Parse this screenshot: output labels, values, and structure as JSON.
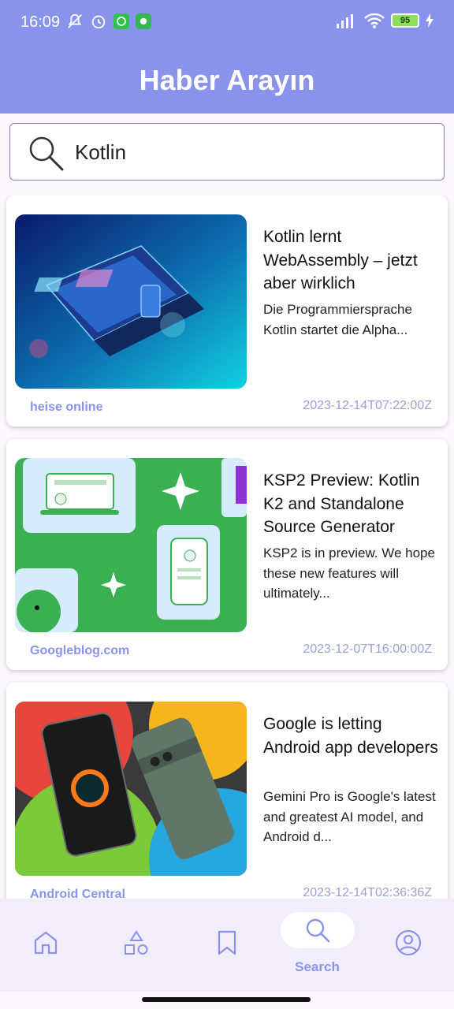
{
  "status_bar": {
    "time": "16:09",
    "battery_level": "95",
    "icons": [
      "mute-icon",
      "alarm-icon",
      "whatsapp-icon",
      "android-notification-icon",
      "signal-icon",
      "wifi-icon",
      "battery-icon",
      "charging-icon"
    ]
  },
  "app": {
    "title": "Haber Arayın"
  },
  "search": {
    "query": "Kotlin",
    "icon": "search-icon"
  },
  "articles": [
    {
      "title": "Kotlin lernt WebAssembly – jetzt aber wirklich",
      "description": "Die Programmiersprache Kotlin startet die Alpha...",
      "source": "heise online",
      "published_at": "2023-12-14T07:22:00Z"
    },
    {
      "title": "KSP2 Preview: Kotlin K2 and Standalone Source Generator",
      "description": "KSP2 is in preview. We hope these new features will ultimately...",
      "source": "Googleblog.com",
      "published_at": "2023-12-07T16:00:00Z"
    },
    {
      "title": "Google is letting Android app developers",
      "description": "Gemini Pro is Google's latest and greatest AI model, and Android d...",
      "source": "Android Central",
      "published_at": "2023-12-14T02:36:36Z"
    }
  ],
  "bottom_nav": {
    "items": [
      {
        "icon": "home-icon",
        "label": ""
      },
      {
        "icon": "categories-icon",
        "label": ""
      },
      {
        "icon": "bookmark-icon",
        "label": ""
      },
      {
        "icon": "search-icon",
        "label": "Search",
        "active": true
      },
      {
        "icon": "profile-icon",
        "label": ""
      }
    ]
  },
  "colors": {
    "primary": "#8a93ec",
    "background": "#fbf7fd",
    "nav_background": "#f2edfa"
  }
}
